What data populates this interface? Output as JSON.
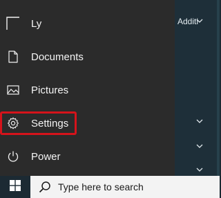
{
  "start_menu": {
    "items": [
      {
        "label": "Ly",
        "icon": "user-avatar-icon"
      },
      {
        "label": "Documents",
        "icon": "document-icon"
      },
      {
        "label": "Pictures",
        "icon": "picture-icon"
      },
      {
        "label": "Settings",
        "icon": "gear-icon"
      },
      {
        "label": "Power",
        "icon": "power-icon"
      }
    ],
    "highlighted_item": "Settings",
    "highlight_color": "#d5131b"
  },
  "background_app": {
    "visible_text": "Additi"
  },
  "taskbar": {
    "start_icon": "windows-logo-icon",
    "search": {
      "icon": "search-icon",
      "placeholder": "Type here to search"
    }
  },
  "colors": {
    "menu_background": "#2b2b2b",
    "taskbar_background": "#1c2a33",
    "search_background": "#f3f3f3"
  }
}
